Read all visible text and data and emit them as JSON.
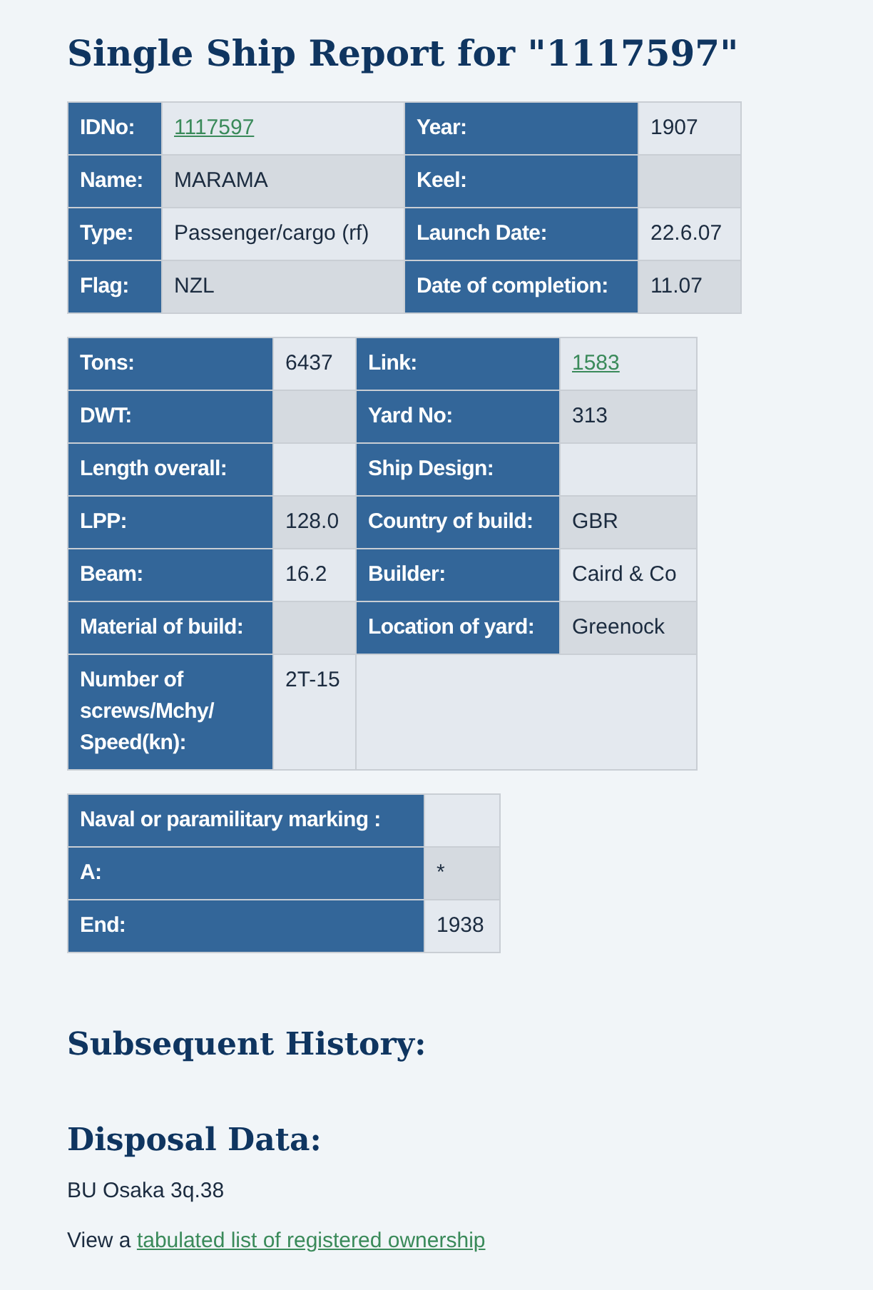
{
  "title": "Single Ship Report for \"1117597\"",
  "tables": [
    {
      "rows": [
        [
          {
            "kind": "label",
            "text": "IDNo:"
          },
          {
            "kind": "link",
            "text": "1117597"
          },
          {
            "kind": "label",
            "text": "Year:"
          },
          {
            "kind": "value",
            "text": "1907"
          }
        ],
        [
          {
            "kind": "label",
            "text": "Name:"
          },
          {
            "kind": "value",
            "text": "MARAMA"
          },
          {
            "kind": "label",
            "text": "Keel:"
          },
          {
            "kind": "empty"
          }
        ],
        [
          {
            "kind": "label",
            "text": "Type:"
          },
          {
            "kind": "value",
            "text": "Passenger/cargo (rf)"
          },
          {
            "kind": "label",
            "text": "Launch Date:"
          },
          {
            "kind": "value",
            "text": "22.6.07"
          }
        ],
        [
          {
            "kind": "label",
            "text": "Flag:"
          },
          {
            "kind": "value",
            "text": "NZL"
          },
          {
            "kind": "label",
            "text": "Date of completion:"
          },
          {
            "kind": "value",
            "text": "11.07"
          }
        ]
      ]
    },
    {
      "rows": [
        [
          {
            "kind": "label",
            "text": "Tons:"
          },
          {
            "kind": "value",
            "text": "6437"
          },
          {
            "kind": "label",
            "text": "Link:"
          },
          {
            "kind": "link",
            "text": "1583"
          }
        ],
        [
          {
            "kind": "label",
            "text": "DWT:"
          },
          {
            "kind": "empty"
          },
          {
            "kind": "label",
            "text": "Yard No:"
          },
          {
            "kind": "value",
            "text": "313"
          }
        ],
        [
          {
            "kind": "label",
            "text": "Length overall:"
          },
          {
            "kind": "empty"
          },
          {
            "kind": "label",
            "text": "Ship Design:"
          },
          {
            "kind": "empty"
          }
        ],
        [
          {
            "kind": "label",
            "text": "LPP:"
          },
          {
            "kind": "value",
            "text": "128.0"
          },
          {
            "kind": "label",
            "text": "Country of build:"
          },
          {
            "kind": "value",
            "text": "GBR"
          }
        ],
        [
          {
            "kind": "label",
            "text": "Beam:"
          },
          {
            "kind": "value",
            "text": "16.2"
          },
          {
            "kind": "label",
            "text": "Builder:"
          },
          {
            "kind": "value",
            "text": "Caird & Co"
          }
        ],
        [
          {
            "kind": "label",
            "text": "Material of build:"
          },
          {
            "kind": "empty"
          },
          {
            "kind": "label",
            "text": "Location of yard:"
          },
          {
            "kind": "value",
            "text": "Greenock"
          }
        ],
        [
          {
            "kind": "label",
            "text": "Number of screws/Mchy/ Speed(kn):"
          },
          {
            "kind": "value",
            "text": "2T-15"
          },
          {
            "kind": "filler"
          }
        ]
      ]
    },
    {
      "rows": [
        [
          {
            "kind": "label",
            "text": "Naval or paramilitary marking :"
          },
          {
            "kind": "empty"
          }
        ],
        [
          {
            "kind": "label",
            "text": "A:"
          },
          {
            "kind": "value",
            "text": "*"
          }
        ],
        [
          {
            "kind": "label",
            "text": "End:"
          },
          {
            "kind": "value",
            "text": "1938"
          }
        ]
      ]
    }
  ],
  "subsequent_history": {
    "heading": "Subsequent History:"
  },
  "disposal": {
    "heading": "Disposal Data:",
    "text": "BU Osaka 3q.38",
    "link_prefix": "View a",
    "link": "tabulated list of registered ownership"
  }
}
